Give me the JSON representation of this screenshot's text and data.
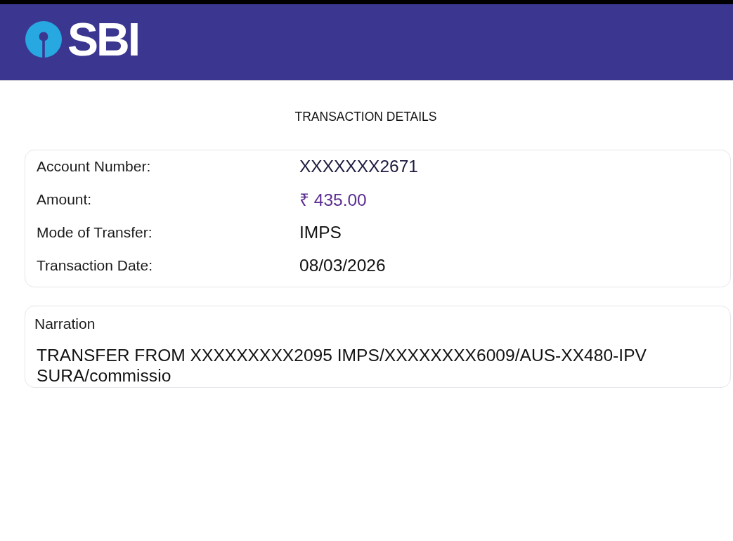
{
  "header": {
    "logo_text": "SBI"
  },
  "title": "TRANSACTION DETAILS",
  "details": [
    {
      "label": "Account Number:",
      "value": "XXXXXXX2671",
      "kind": "account"
    },
    {
      "label": "Amount:",
      "value": "₹ 435.00",
      "kind": "amount"
    },
    {
      "label": "Mode of Transfer:",
      "value": "IMPS",
      "kind": "text"
    },
    {
      "label": "Transaction Date:",
      "value": "08/03/2026",
      "kind": "text"
    }
  ],
  "narration": {
    "label": "Narration",
    "text": "TRANSFER FROM XXXXXXXXX2095 IMPS/XXXXXXXX6009/AUS-XX480-IPV SURA/commissio"
  }
}
